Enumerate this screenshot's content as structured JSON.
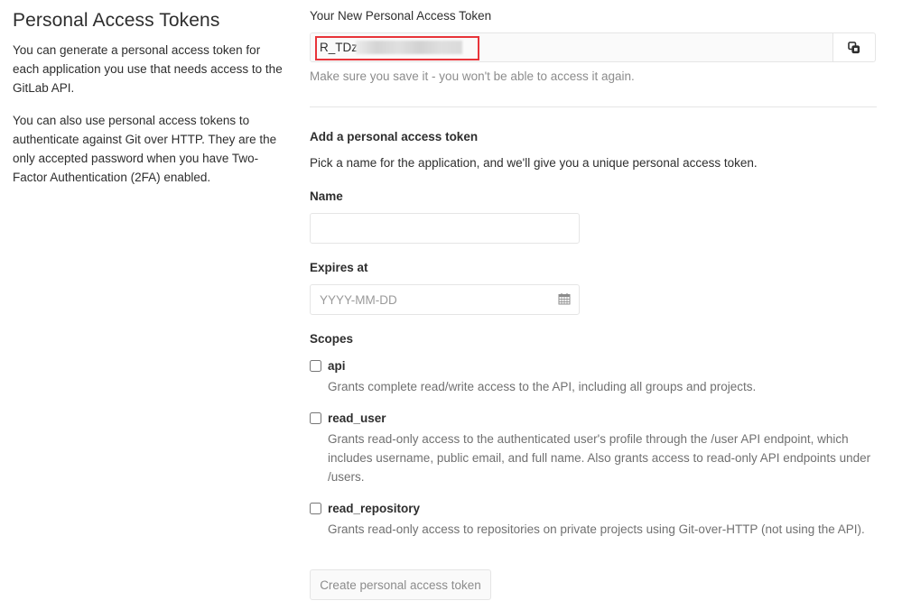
{
  "sidebar": {
    "title": "Personal Access Tokens",
    "paragraphs": [
      "You can generate a personal access token for each application you use that needs access to the GitLab API.",
      "You can also use personal access tokens to authenticate against Git over HTTP. They are the only accepted password when you have Two-Factor Authentication (2FA) enabled."
    ]
  },
  "new_token": {
    "label": "Your New Personal Access Token",
    "value_visible": "R_TDzt",
    "copy_icon": "clipboard-copy-icon",
    "help": "Make sure you save it - you won't be able to access it again.",
    "highlight_color": "#e8343a"
  },
  "form": {
    "title": "Add a personal access token",
    "description": "Pick a name for the application, and we'll give you a unique personal access token.",
    "name": {
      "label": "Name",
      "value": "",
      "placeholder": ""
    },
    "expires": {
      "label": "Expires at",
      "value": "",
      "placeholder": "YYYY-MM-DD",
      "icon": "calendar-icon"
    },
    "scopes_label": "Scopes",
    "scopes": [
      {
        "name": "api",
        "checked": false,
        "description": "Grants complete read/write access to the API, including all groups and projects."
      },
      {
        "name": "read_user",
        "checked": false,
        "description": "Grants read-only access to the authenticated user's profile through the /user API endpoint, which includes username, public email, and full name. Also grants access to read-only API endpoints under /users."
      },
      {
        "name": "read_repository",
        "checked": false,
        "description": "Grants read-only access to repositories on private projects using Git-over-HTTP (not using the API)."
      }
    ],
    "submit_label": "Create personal access token",
    "submit_disabled": true
  }
}
